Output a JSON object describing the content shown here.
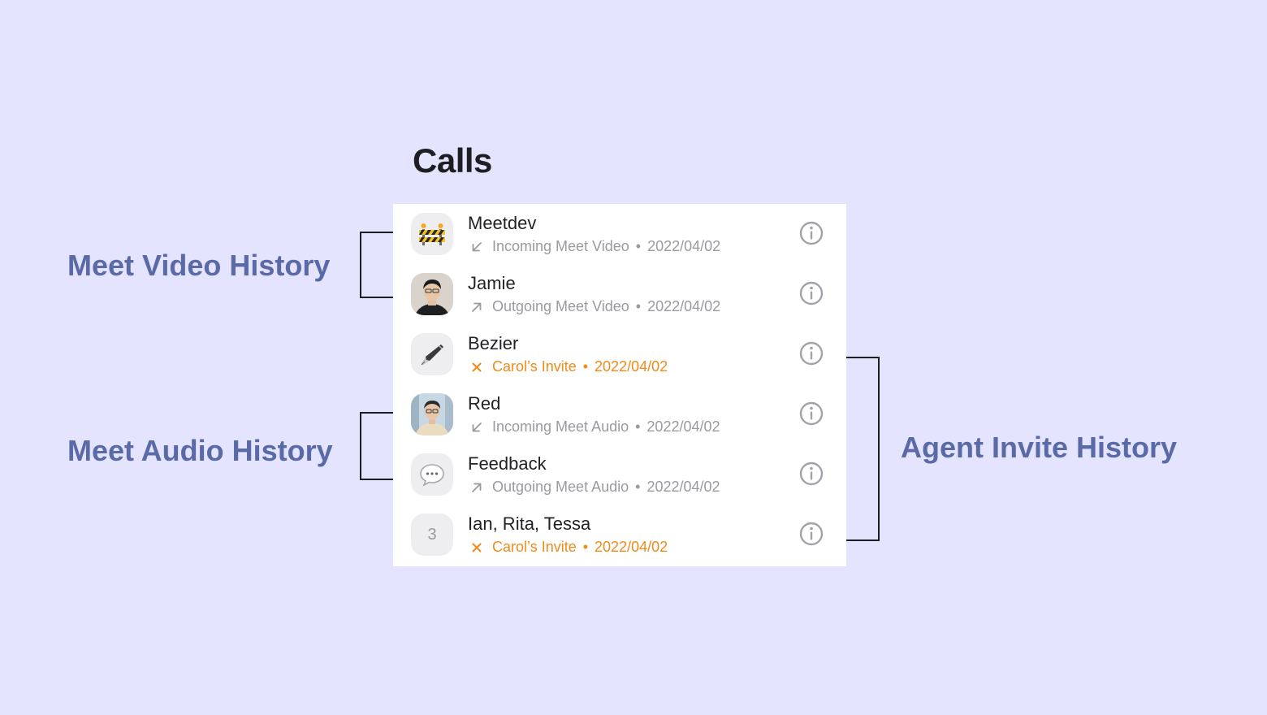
{
  "page": {
    "title": "Calls"
  },
  "calls": [
    {
      "name": "Meetdev",
      "direction": "incoming",
      "detail": "Incoming Meet Video",
      "date": "2022/04/02",
      "avatar": "construction-avatar",
      "highlight": false
    },
    {
      "name": "Jamie",
      "direction": "outgoing",
      "detail": "Outgoing Meet Video",
      "date": "2022/04/02",
      "avatar": "photo-avatar",
      "highlight": false
    },
    {
      "name": "Bezier",
      "direction": "invite",
      "detail": "Carol’s Invite",
      "date": "2022/04/02",
      "avatar": "pen-avatar",
      "highlight": true
    },
    {
      "name": "Red",
      "direction": "incoming",
      "detail": "Incoming Meet Audio",
      "date": "2022/04/02",
      "avatar": "photo-avatar",
      "highlight": false
    },
    {
      "name": "Feedback",
      "direction": "outgoing",
      "detail": "Outgoing Meet Audio",
      "date": "2022/04/02",
      "avatar": "speech-bubble-avatar",
      "highlight": false
    },
    {
      "name": "Ian, Rita, Tessa",
      "direction": "invite",
      "detail": "Carol’s Invite",
      "date": "2022/04/02",
      "avatar": "group-count-avatar",
      "avatar_text": "3",
      "highlight": true
    }
  ],
  "separator": "•",
  "annotations": {
    "video": "Meet Video History",
    "audio": "Meet Audio History",
    "agent": "Agent Invite History"
  },
  "colors": {
    "background": "#e4e4fe",
    "annotation": "#5a6aa6",
    "muted_text": "#9a9aa0",
    "invite_accent": "#f08a1a"
  }
}
